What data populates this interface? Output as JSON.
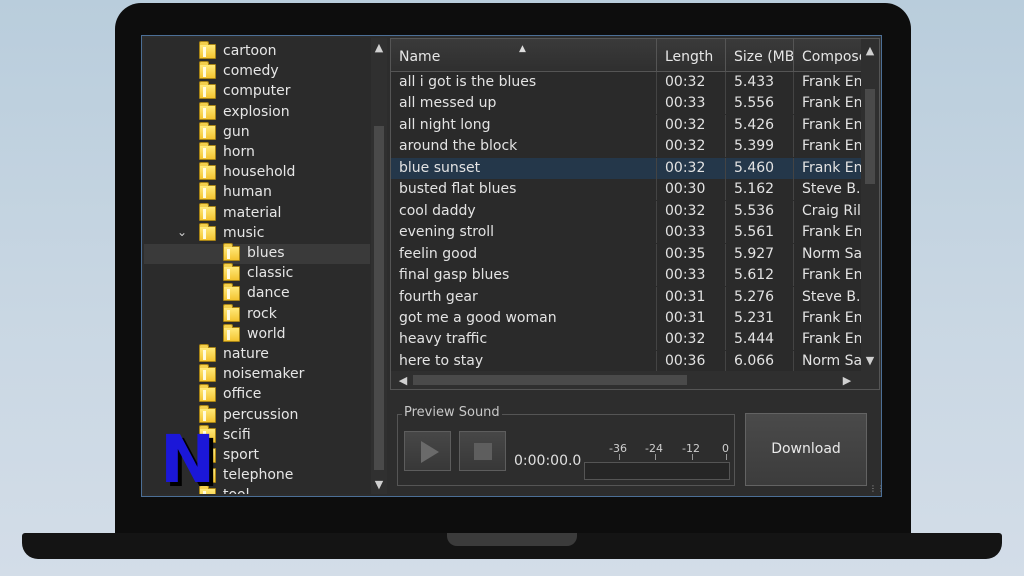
{
  "tree": {
    "items": [
      {
        "label": "cartoon",
        "level": 0
      },
      {
        "label": "comedy",
        "level": 0
      },
      {
        "label": "computer",
        "level": 0
      },
      {
        "label": "explosion",
        "level": 0
      },
      {
        "label": "gun",
        "level": 0
      },
      {
        "label": "horn",
        "level": 0
      },
      {
        "label": "household",
        "level": 0
      },
      {
        "label": "human",
        "level": 0
      },
      {
        "label": "material",
        "level": 0
      },
      {
        "label": "music",
        "level": 0,
        "expanded": true
      },
      {
        "label": "blues",
        "level": 1,
        "selected": true
      },
      {
        "label": "classic",
        "level": 1
      },
      {
        "label": "dance",
        "level": 1
      },
      {
        "label": "rock",
        "level": 1
      },
      {
        "label": "world",
        "level": 1
      },
      {
        "label": "nature",
        "level": 0
      },
      {
        "label": "noisemaker",
        "level": 0
      },
      {
        "label": "office",
        "level": 0
      },
      {
        "label": "percussion",
        "level": 0
      },
      {
        "label": "scifi",
        "level": 0
      },
      {
        "label": "sport",
        "level": 0
      },
      {
        "label": "telephone",
        "level": 0
      },
      {
        "label": "tool",
        "level": 0
      }
    ]
  },
  "logo": {
    "letter": "N",
    "color": "#1b17d8"
  },
  "table": {
    "columns": [
      "Name",
      "Length",
      "Size (MB)",
      "Compose"
    ],
    "rows": [
      {
        "name": "all i got is the blues",
        "length": "00:32",
        "size": "5.433",
        "composer": "Frank Enc"
      },
      {
        "name": "all messed up",
        "length": "00:33",
        "size": "5.556",
        "composer": "Frank Enc"
      },
      {
        "name": "all night long",
        "length": "00:32",
        "size": "5.426",
        "composer": "Frank Enc"
      },
      {
        "name": "around the block",
        "length": "00:32",
        "size": "5.399",
        "composer": "Frank Enc"
      },
      {
        "name": "blue sunset",
        "length": "00:32",
        "size": "5.460",
        "composer": "Frank Enc",
        "selected": true
      },
      {
        "name": "busted flat blues",
        "length": "00:30",
        "size": "5.162",
        "composer": "Steve B."
      },
      {
        "name": "cool daddy",
        "length": "00:32",
        "size": "5.536",
        "composer": "Craig Rile"
      },
      {
        "name": "evening stroll",
        "length": "00:33",
        "size": "5.561",
        "composer": "Frank Enc"
      },
      {
        "name": "feelin good",
        "length": "00:35",
        "size": "5.927",
        "composer": "Norm Sab"
      },
      {
        "name": "final gasp blues",
        "length": "00:33",
        "size": "5.612",
        "composer": "Frank Enc"
      },
      {
        "name": "fourth gear",
        "length": "00:31",
        "size": "5.276",
        "composer": "Steve B."
      },
      {
        "name": "got me a good woman",
        "length": "00:31",
        "size": "5.231",
        "composer": "Frank Enc"
      },
      {
        "name": "heavy traffic",
        "length": "00:32",
        "size": "5.444",
        "composer": "Frank Enc"
      },
      {
        "name": "here to stay",
        "length": "00:36",
        "size": "6.066",
        "composer": "Norm Sab"
      }
    ]
  },
  "preview": {
    "title": "Preview Sound",
    "time": "0:00:00.0",
    "meter_labels": [
      "-36",
      "-24",
      "-12",
      "0"
    ]
  },
  "download_label": "Download",
  "colors": {
    "selection": "#24374a",
    "folder": "#f4c431",
    "accent_border": "#4c6f96"
  }
}
